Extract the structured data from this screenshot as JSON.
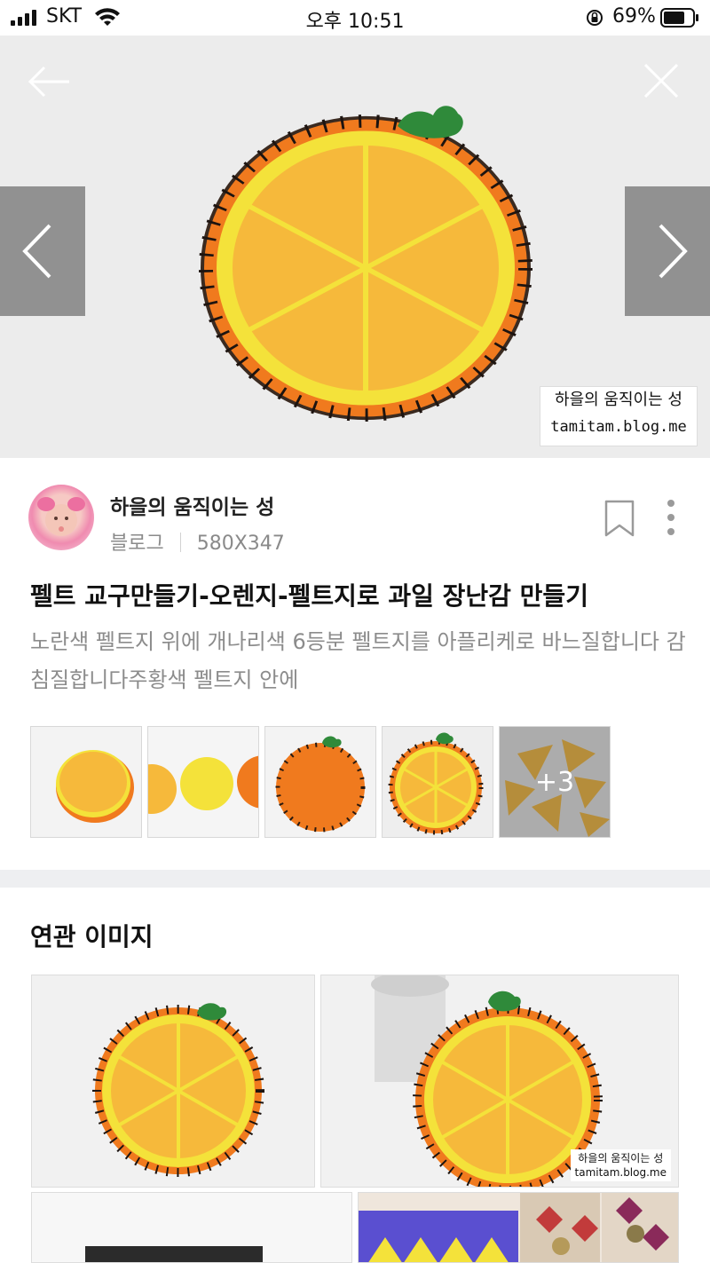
{
  "status_bar": {
    "carrier": "SKT",
    "time": "오후 10:51",
    "battery": "69%"
  },
  "viewer": {
    "watermark_name": "하을의 움직이는 성",
    "watermark_url": "tamitam.blog.me"
  },
  "post": {
    "author": "하을의 움직이는 성",
    "source_type": "블로그",
    "dimensions": "580X347",
    "title": "펠트 교구만들기-오렌지-펠트지로 과일 장난감 만들기",
    "description": "노란색 펠트지 위에 개나리색 6등분 펠트지를 아플리케로 바느질합니다 감침질합니다주황색 펠트지 안에",
    "thumbs_more": "+3"
  },
  "related": {
    "heading": "연관 이미지",
    "watermark_name": "하을의 움직이는 성",
    "watermark_url": "tamitam.blog.me"
  },
  "colors": {
    "divider": "#eeeff1",
    "secondary_text": "#8c8c8c",
    "orange": "#f07a1e",
    "yellow": "#f5e23a",
    "segment": "#f6b93b"
  }
}
